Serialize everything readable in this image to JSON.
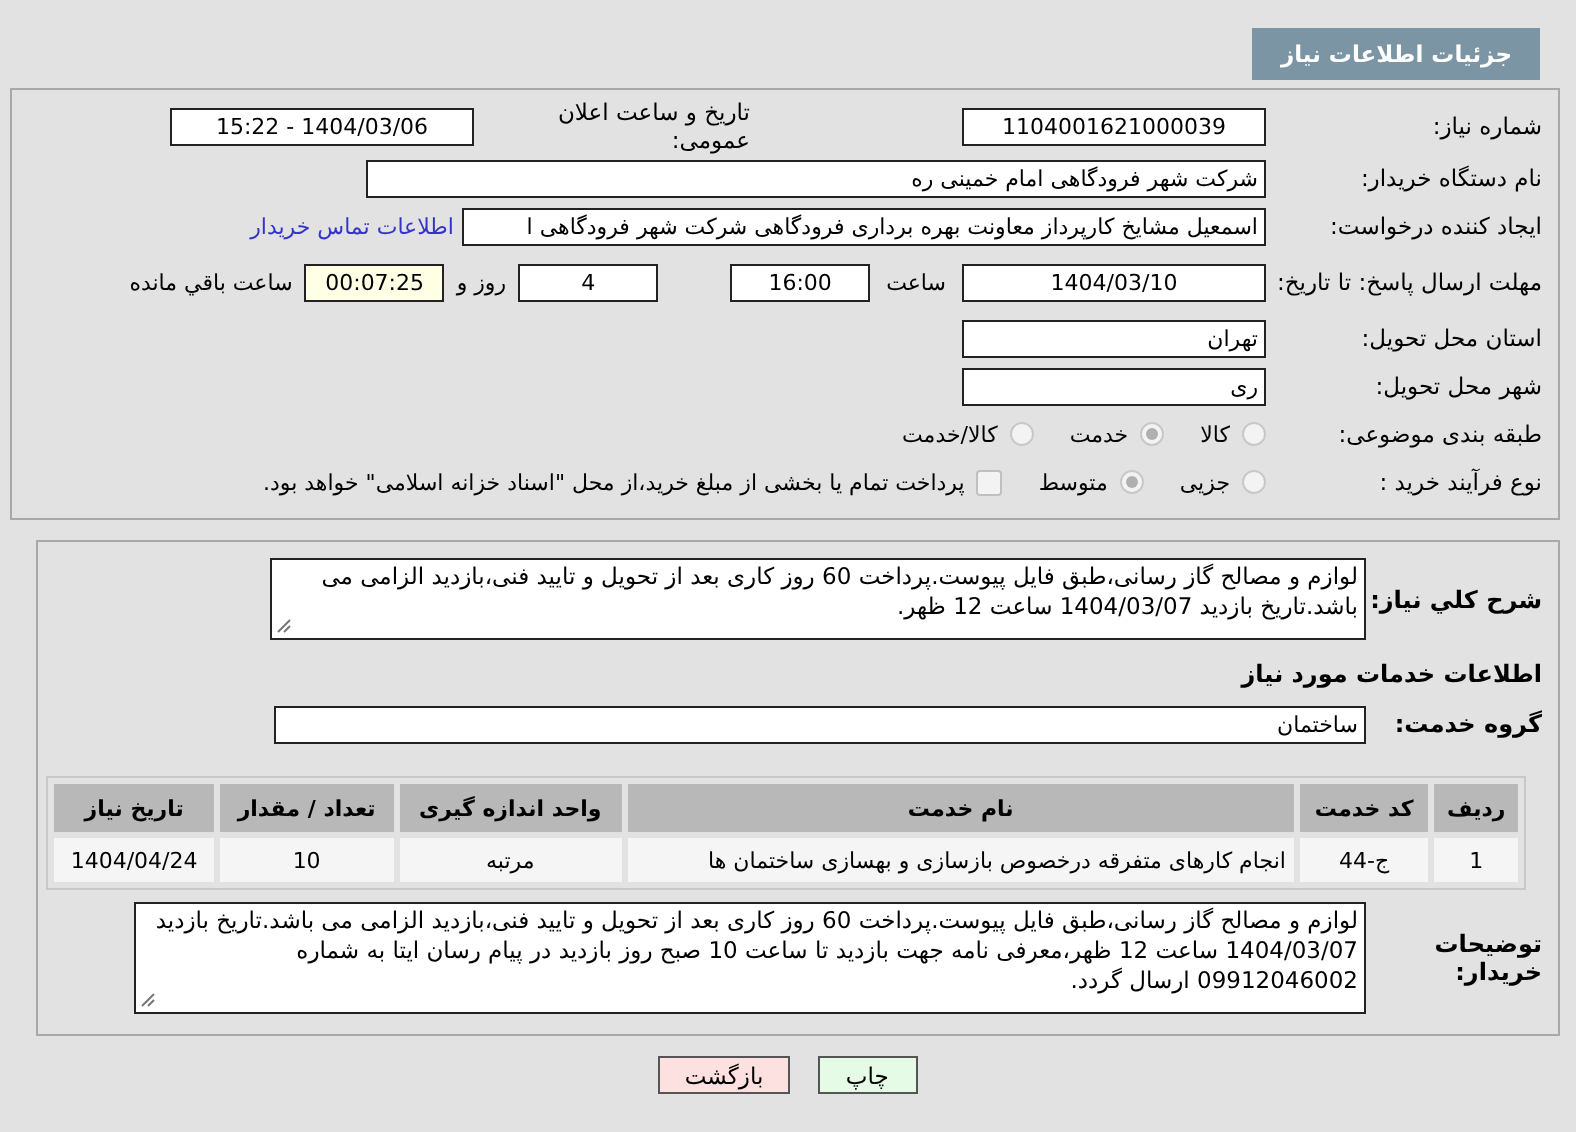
{
  "header": {
    "title": "جزئیات اطلاعات نیاز"
  },
  "need_number": {
    "label": "شماره نیاز:",
    "value": "1104001621000039"
  },
  "announce": {
    "label": "تاریخ و ساعت اعلان عمومی:",
    "value": "1404/03/06 - 15:22"
  },
  "buyer_org": {
    "label": "نام دستگاه خریدار:",
    "value": "شرکت شهر فرودگاهی امام خمینی  ره"
  },
  "requester": {
    "label": "ایجاد کننده درخواست:",
    "value": "اسمعیل مشایخ کارپرداز معاونت بهره برداری فرودگاهی شرکت شهر فرودگاهی ا",
    "link": "اطلاعات تماس خریدار"
  },
  "deadline": {
    "label": "مهلت ارسال پاسخ: تا تاریخ:",
    "date": "1404/03/10",
    "time_label": "ساعت",
    "time": "16:00",
    "days": "4",
    "days_label": "روز و",
    "remaining": "00:07:25",
    "remaining_label": "ساعت باقي مانده"
  },
  "province": {
    "label": "استان محل تحویل:",
    "value": "تهران"
  },
  "city": {
    "label": "شهر محل تحویل:",
    "value": "ری"
  },
  "category": {
    "label": "طبقه بندی موضوعی:",
    "options": [
      {
        "label": "کالا",
        "selected": false
      },
      {
        "label": "خدمت",
        "selected": true
      },
      {
        "label": "کالا/خدمت",
        "selected": false
      }
    ]
  },
  "process": {
    "label": "نوع فرآیند خرید :",
    "options": [
      {
        "label": "جزیی",
        "selected": false
      },
      {
        "label": "متوسط",
        "selected": true
      }
    ],
    "payment": {
      "label": "پرداخت تمام یا بخشی از مبلغ خرید،از محل \"اسناد خزانه اسلامی\" خواهد بود.",
      "checked": false
    }
  },
  "description": {
    "label": "شرح کلي نیاز:",
    "value": "لوازم و مصالح گاز رسانی،طبق فایل پیوست.پرداخت 60 روز کاری بعد از تحویل و تایید فنی،بازدید الزامی می باشد.تاریخ بازدید 1404/03/07 ساعت 12 ظهر."
  },
  "services_heading": "اطلاعات خدمات مورد نیاز",
  "service_group": {
    "label": "گروه خدمت:",
    "value": "ساختمان"
  },
  "table": {
    "columns": [
      "ردیف",
      "کد خدمت",
      "نام خدمت",
      "واحد اندازه گیری",
      "تعداد / مقدار",
      "تاریخ نیاز"
    ],
    "rows": [
      [
        "1",
        "ج-44",
        "انجام کارهای متفرقه درخصوص بازسازی و بهسازی ساختمان ها",
        "مرتبه",
        "10",
        "1404/04/24"
      ]
    ]
  },
  "buyer_notes": {
    "label": "توضیحات خریدار:",
    "value": "لوازم و مصالح گاز رسانی،طبق فایل پیوست.پرداخت 60 روز کاری بعد از تحویل و تایید فنی،بازدید الزامی می باشد.تاریخ بازدید 1404/03/07 ساعت 12 ظهر،معرفی نامه جهت بازدید تا ساعت 10 صبح روز بازدید در پیام رسان ایتا به شماره 09912046002 ارسال گردد."
  },
  "buttons": [
    {
      "label": "چاپ",
      "kind": "print"
    },
    {
      "label": "بازگشت",
      "kind": "back"
    }
  ]
}
